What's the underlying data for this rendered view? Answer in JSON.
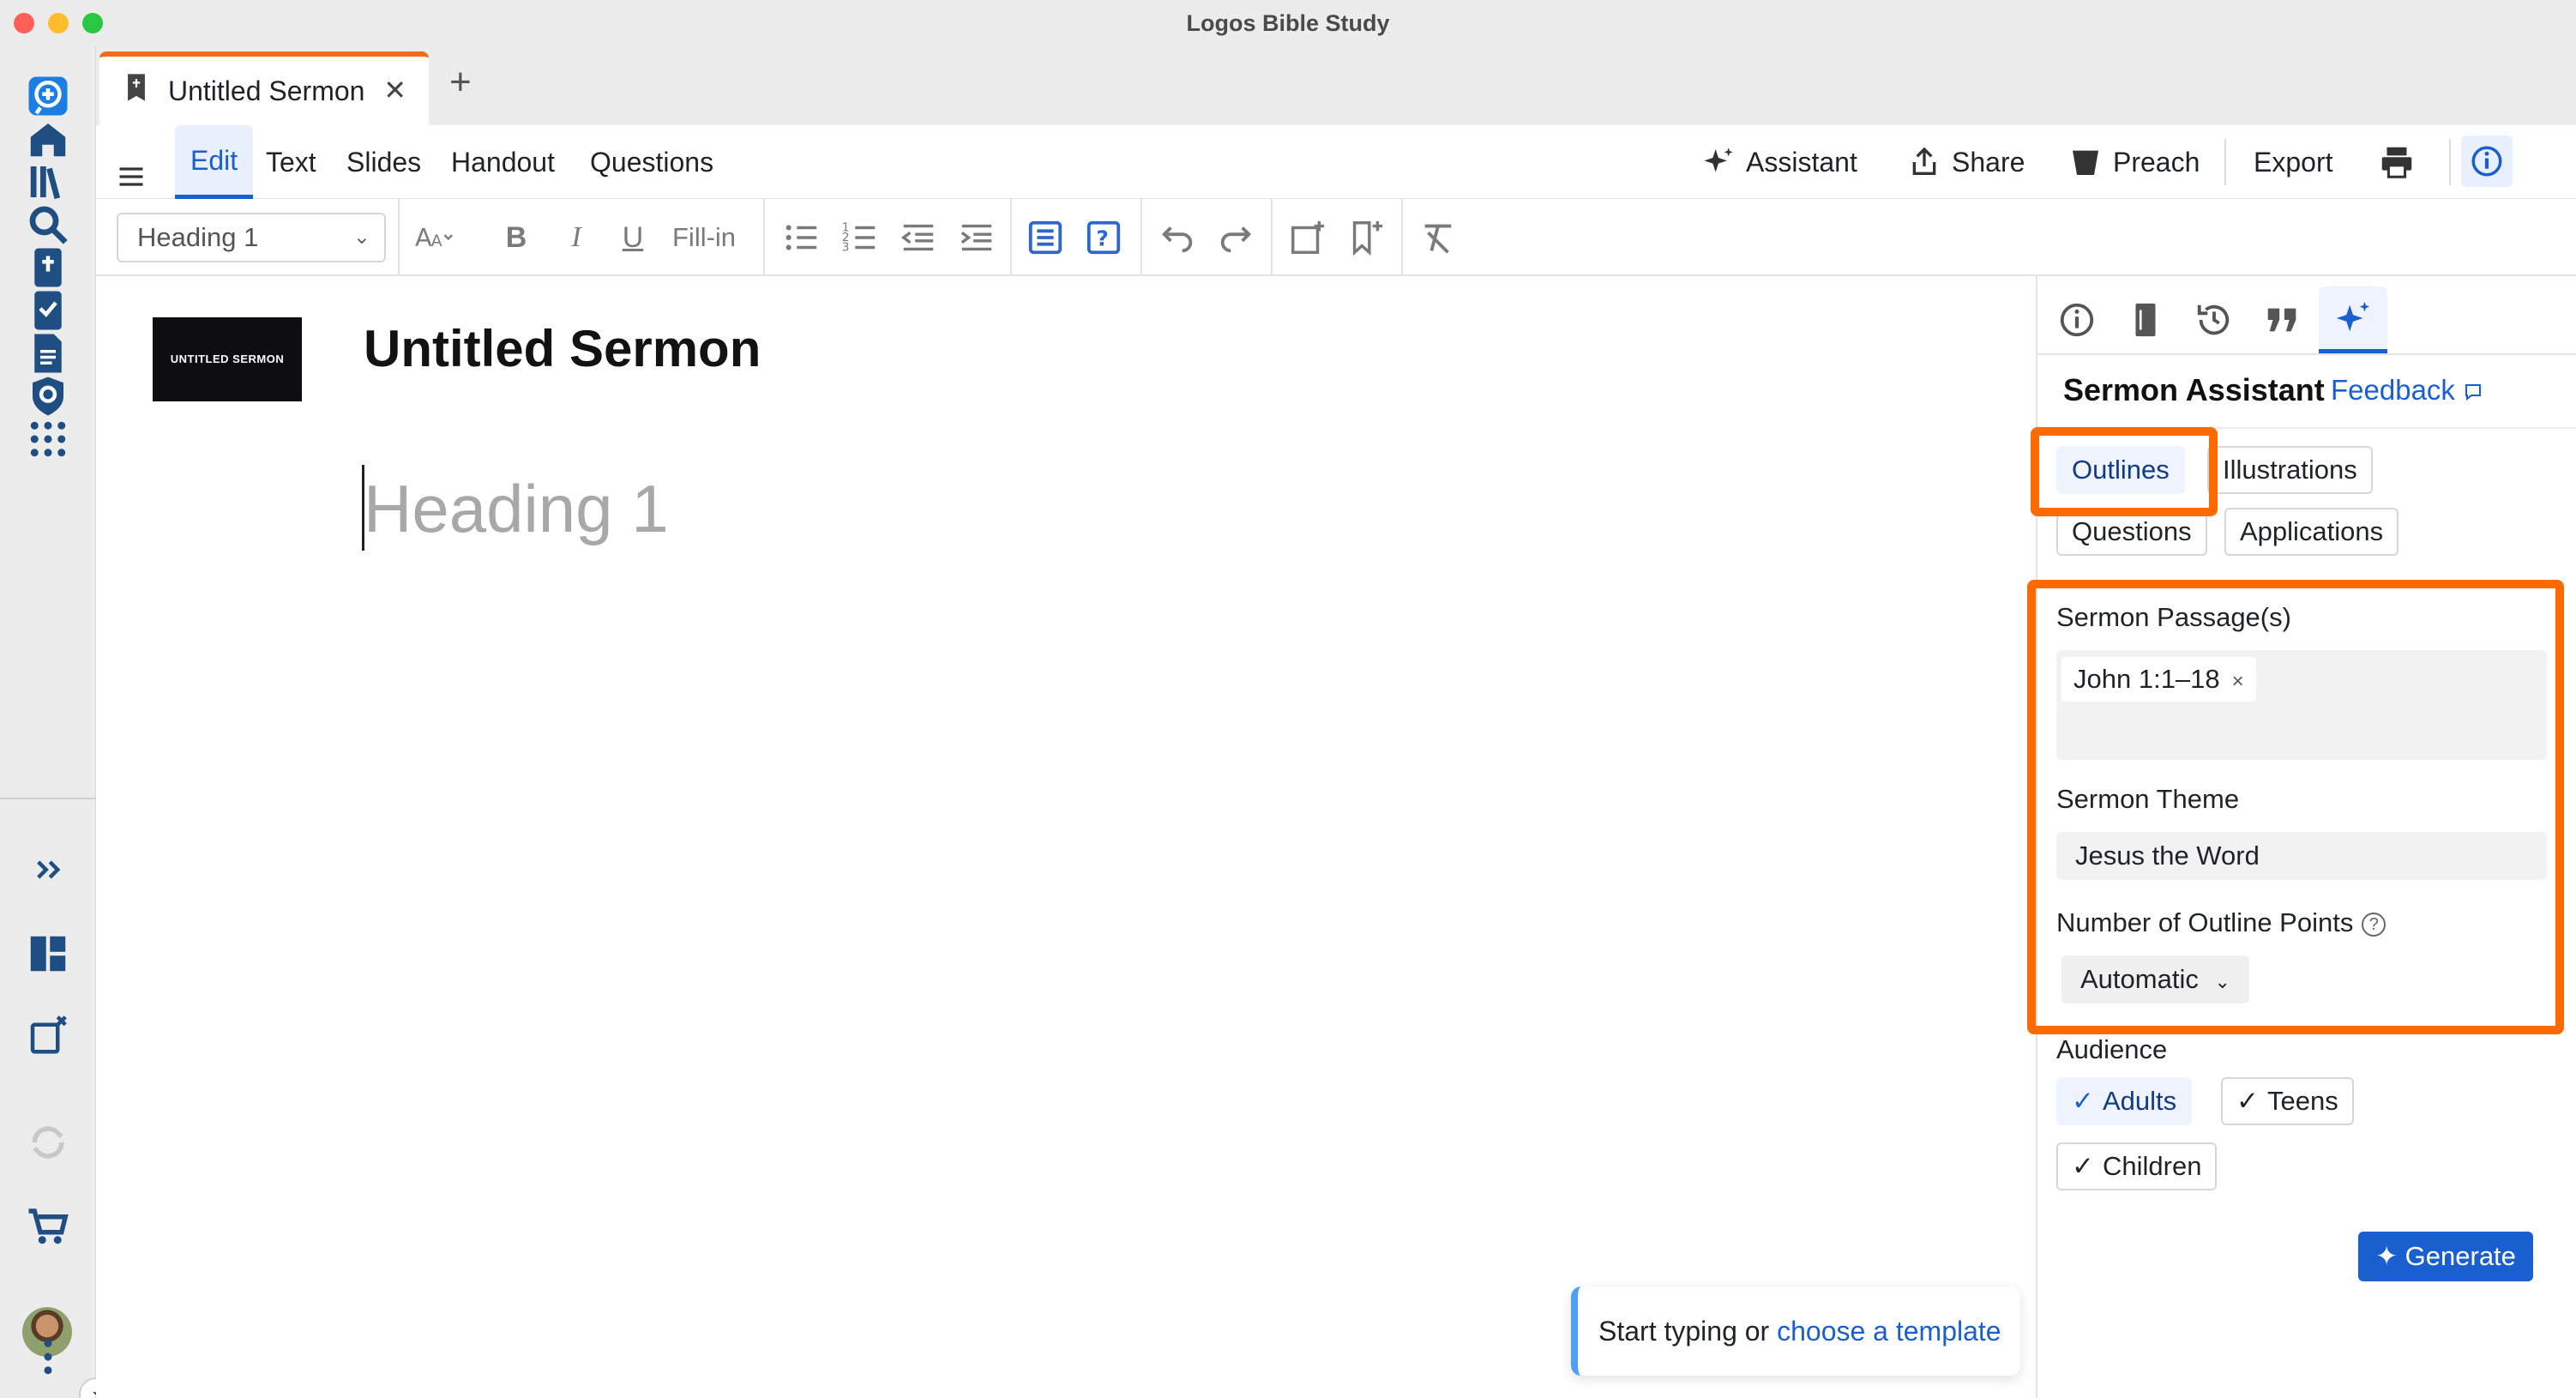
{
  "window": {
    "title": "Logos Bible Study"
  },
  "tabs": [
    {
      "label": "Untitled Sermon",
      "close": "✕"
    }
  ],
  "new_tab": "+",
  "menu": {
    "items": [
      "Edit",
      "Text",
      "Slides",
      "Handout",
      "Questions"
    ],
    "right": {
      "assistant": "Assistant",
      "share": "Share",
      "preach": "Preach",
      "export": "Export"
    }
  },
  "toolbar": {
    "style_select": "Heading 1",
    "fill_in": "Fill-in",
    "bold": "B",
    "italic": "I",
    "underline": "U"
  },
  "editor": {
    "thumbnail_text": "UNTITLED SERMON",
    "title": "Untitled Sermon",
    "heading_placeholder": "Heading 1",
    "hint_prefix": "Start typing or ",
    "hint_link": "choose a template"
  },
  "panel": {
    "title": "Sermon Assistant",
    "feedback": "Feedback",
    "modes": [
      "Outlines",
      "Illustrations",
      "Questions",
      "Applications"
    ],
    "selected_mode": "Outlines",
    "passage_label": "Sermon Passage(s)",
    "passages": [
      "John 1:1–18"
    ],
    "chip_remove": "×",
    "theme_label": "Sermon Theme",
    "theme_value": "Jesus the Word",
    "points_label": "Number of Outline Points",
    "help": "?",
    "points_value": "Automatic",
    "audience_label": "Audience",
    "audiences": [
      {
        "label": "Adults",
        "checked": true
      },
      {
        "label": "Teens",
        "checked": true
      },
      {
        "label": "Children",
        "checked": true
      }
    ],
    "generate": "Generate"
  },
  "colors": {
    "accent": "#1a5fd0",
    "highlight": "#ff6a00",
    "tab_accent": "#f26a1b"
  }
}
